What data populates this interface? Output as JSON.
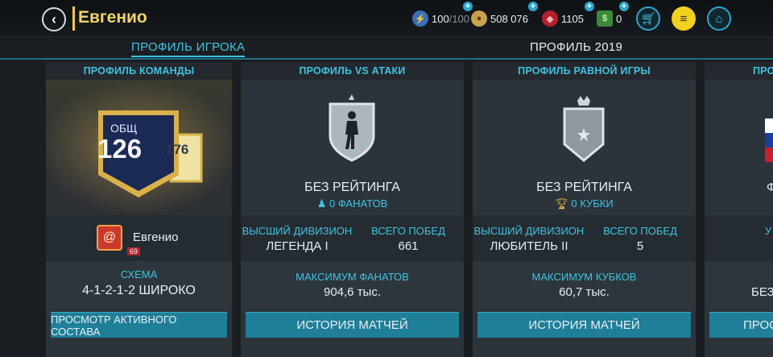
{
  "header": {
    "back_icon": "chevron-left-icon",
    "title": "Евгенио",
    "resources": [
      {
        "name": "energy",
        "icon": "lightning-icon",
        "value": "100",
        "max": "/100"
      },
      {
        "name": "coins",
        "icon": "coin-icon",
        "value": "508 076"
      },
      {
        "name": "points",
        "icon": "gem-icon",
        "value": "1105"
      },
      {
        "name": "tokens",
        "icon": "cash-icon",
        "value": "0"
      }
    ],
    "plus_symbol": "+",
    "shop_icon": "cart-icon",
    "menu_icon": "list-menu-icon",
    "home_icon": "home-icon"
  },
  "tabs": [
    {
      "label": "ПРОФИЛЬ ИГРОКА",
      "active": true
    },
    {
      "label": "ПРОФИЛЬ 2019",
      "active": false
    }
  ],
  "team_card": {
    "heading": "ПРОФИЛЬ КОМАНДЫ",
    "ovr_label": "ОБЩ",
    "ovr_value": "126",
    "secondary_value": "176",
    "manager_name": "Евгенио",
    "manager_level": "69",
    "formation_label": "СХЕМА",
    "formation_value": "4-1-2-1-2 ШИРОКО",
    "button": "ПРОСМОТР АКТИВНОГО СОСТАВА"
  },
  "vs_attack_card": {
    "heading": "ПРОФИЛЬ VS АТАКИ",
    "rating": "БЕЗ РЕЙТИНГА",
    "fans": "0 ФАНАТОВ",
    "division_label": "ВЫСШИЙ ДИВИЗИОН",
    "division_value": "ЛЕГЕНДА I",
    "wins_label": "ВСЕГО ПОБЕД",
    "wins_value": "661",
    "max_label": "МАКСИМУМ ФАНАТОВ",
    "max_value": "904,6 тыс.",
    "button": "ИСТОРИЯ МАТЧЕЙ"
  },
  "h2h_card": {
    "heading": "ПРОФИЛЬ РАВНОЙ ИГРЫ",
    "rating": "БЕЗ РЕЙТИНГА",
    "cups": "0 КУБКИ",
    "division_label": "ВЫСШИЙ ДИВИЗИОН",
    "division_value": "ЛЮБИТЕЛЬ II",
    "wins_label": "ВСЕГО ПОБЕД",
    "wins_value": "5",
    "max_label": "МАКСИМУМ КУБКОВ",
    "max_value": "60,7 тыс.",
    "button": "ИСТОРИЯ МАТЧЕЙ"
  },
  "partial_card": {
    "heading": "ПРО",
    "line1": "Ф",
    "line2": "У",
    "line3": "БЕЗ",
    "button": "ПРОС"
  },
  "colors": {
    "accent": "#3fc2e0",
    "button": "#1f7f99",
    "title": "#f2d36b"
  }
}
